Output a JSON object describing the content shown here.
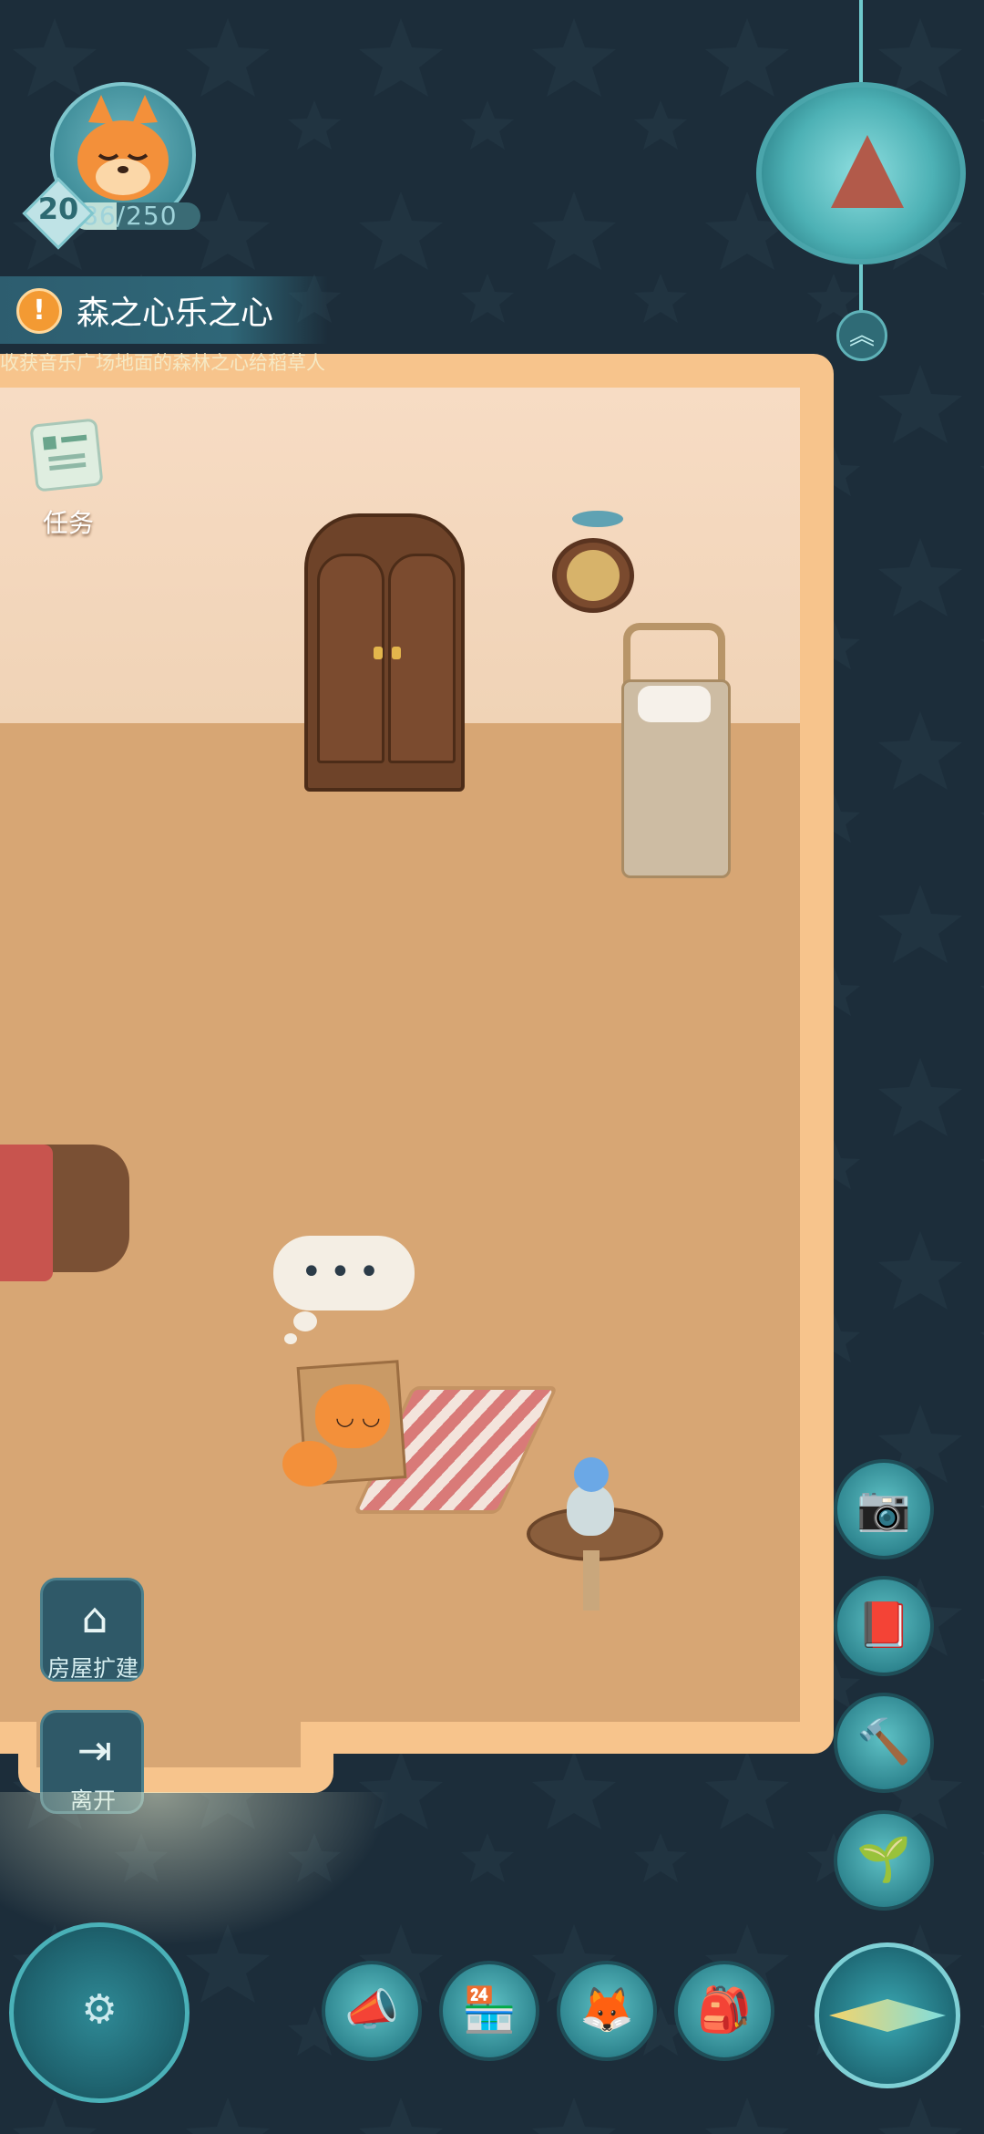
{
  "player": {
    "level": "20",
    "xp_text": "86/250",
    "xp_current": 86,
    "xp_max": 250,
    "avatar_icon": "fox-avatar-icon"
  },
  "quest": {
    "icon": "!",
    "title": "森之心乐之心",
    "description": "收获音乐广场地面的森林之心给稻草人"
  },
  "left_buttons": {
    "task_label": "任务",
    "house_expand_label": "房屋扩建",
    "house_expand_icon": "house-info-icon",
    "leave_label": "离开",
    "leave_icon": "exit-icon"
  },
  "top_right": {
    "globe_icon": "tent-globe-icon",
    "collapse_icon": "double-chevron-up-icon",
    "collapse_glyph": "︽"
  },
  "right_buttons": [
    {
      "name": "camera-icon",
      "glyph": "📷"
    },
    {
      "name": "flower-book-icon",
      "glyph": "📕"
    },
    {
      "name": "hammer-icon",
      "glyph": "🔨"
    },
    {
      "name": "sprout-icon",
      "glyph": "🌱"
    }
  ],
  "bottom_buttons": [
    {
      "name": "megaphone-icon",
      "glyph": "📣"
    },
    {
      "name": "shop-icon",
      "glyph": "🏪"
    },
    {
      "name": "fox-friends-icon",
      "glyph": "🦊"
    },
    {
      "name": "backpack-icon",
      "glyph": "🎒"
    }
  ],
  "thought_bubble": "•••",
  "colors": {
    "background": "#1c2d3a",
    "room_frame": "#f7c48c",
    "floor": "#d7a674",
    "accent_teal": "#4ab1b8",
    "quest_orange": "#f39a33"
  }
}
